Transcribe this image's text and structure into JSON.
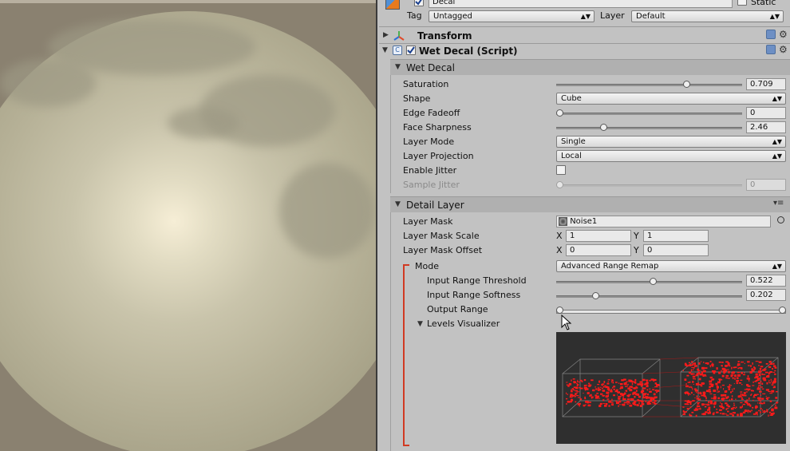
{
  "colors": {
    "inspector_bg": "#c2c2c2",
    "accent_bracket": "#d13a22",
    "visualizer_bg": "#2f2f2f",
    "visualizer_points": "#ff1a1a"
  },
  "header": {
    "name_value": "Decal",
    "static_label": "Static",
    "tag_label": "Tag",
    "tag_value": "Untagged",
    "layer_label": "Layer",
    "layer_value": "Default"
  },
  "components": {
    "transform_title": "Transform",
    "wetdecal_title": "Wet Decal (Script)"
  },
  "wet_decal": {
    "title": "Wet Decal",
    "saturation": {
      "label": "Saturation",
      "value": "0.709",
      "fraction": 0.709
    },
    "shape": {
      "label": "Shape",
      "value": "Cube"
    },
    "edge_fadeoff": {
      "label": "Edge Fadeoff",
      "value": "0",
      "fraction": 0.0
    },
    "face_sharpness": {
      "label": "Face Sharpness",
      "value": "2.46",
      "fraction": 0.246
    },
    "layer_mode": {
      "label": "Layer Mode",
      "value": "Single"
    },
    "layer_projection": {
      "label": "Layer Projection",
      "value": "Local"
    },
    "enable_jitter": {
      "label": "Enable Jitter",
      "checked": false
    },
    "sample_jitter": {
      "label": "Sample Jitter",
      "value": "0",
      "fraction": 0.0
    }
  },
  "detail_layer": {
    "title": "Detail Layer",
    "layer_mask": {
      "label": "Layer Mask",
      "value": "Noise1"
    },
    "layer_mask_scale": {
      "label": "Layer Mask Scale",
      "x_label": "X",
      "x": "1",
      "y_label": "Y",
      "y": "1"
    },
    "layer_mask_offset": {
      "label": "Layer Mask Offset",
      "x_label": "X",
      "x": "0",
      "y_label": "Y",
      "y": "0"
    },
    "mode": {
      "label": "Mode",
      "value": "Advanced Range Remap"
    },
    "input_range_threshold": {
      "label": "Input Range Threshold",
      "value": "0.522",
      "fraction": 0.522
    },
    "input_range_softness": {
      "label": "Input Range Softness",
      "value": "0.202",
      "fraction": 0.202
    },
    "output_range": {
      "label": "Output Range",
      "min_fraction": 0.0,
      "max_fraction": 1.0
    },
    "levels_visualizer": {
      "label": "Levels Visualizer"
    }
  },
  "icons": [
    "foldout-arrow-icon",
    "transform-axes-icon",
    "script-icon",
    "help-book-icon",
    "gear-icon",
    "texture-icon",
    "object-picker-icon",
    "context-menu-icon",
    "cube-gameobject-icon"
  ]
}
